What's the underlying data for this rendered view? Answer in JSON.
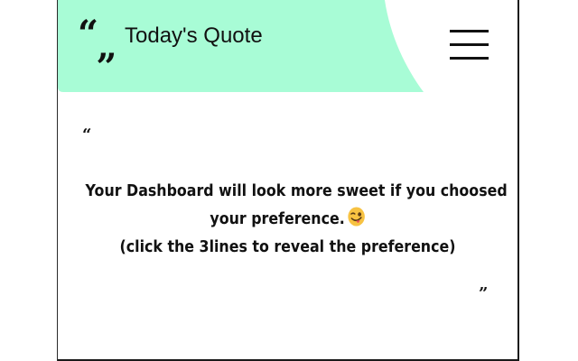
{
  "header": {
    "logo_glyph_open": "“",
    "logo_glyph_close": "„",
    "title": "Today's Quote",
    "menu_icon": "hamburger-menu-icon",
    "accent_color": "#a8fcd6"
  },
  "quote": {
    "open_mark": "“",
    "close_mark": "”",
    "line1": "Your Dashboard will look more sweet if you choosed",
    "line2": "your preference.",
    "emoji": "winking-face-with-tongue-emoji",
    "line3": "(click the 3lines to reveal the preference)"
  }
}
